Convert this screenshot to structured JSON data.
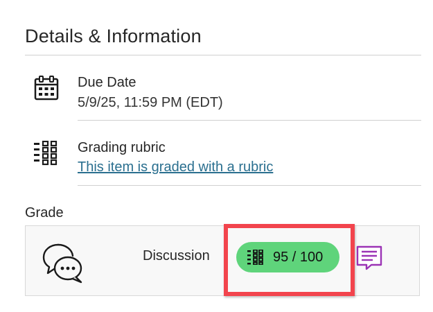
{
  "section": {
    "title": "Details & Information"
  },
  "due_date": {
    "label": "Due Date",
    "value": "5/9/25, 11:59 PM (EDT)",
    "icon": "calendar-icon"
  },
  "rubric": {
    "label": "Grading rubric",
    "link_text": "This item is graded with a rubric",
    "icon": "rubric-grid-icon"
  },
  "grade": {
    "label": "Grade",
    "item_label": "Discussion",
    "item_icon": "discussion-icon",
    "score_text": "95 / 100",
    "score": 95,
    "max_score": 100,
    "pill_color": "#5fd47b",
    "feedback_icon": "feedback-icon",
    "feedback_color": "#9b33b5",
    "highlight_color": "#f2444d"
  }
}
